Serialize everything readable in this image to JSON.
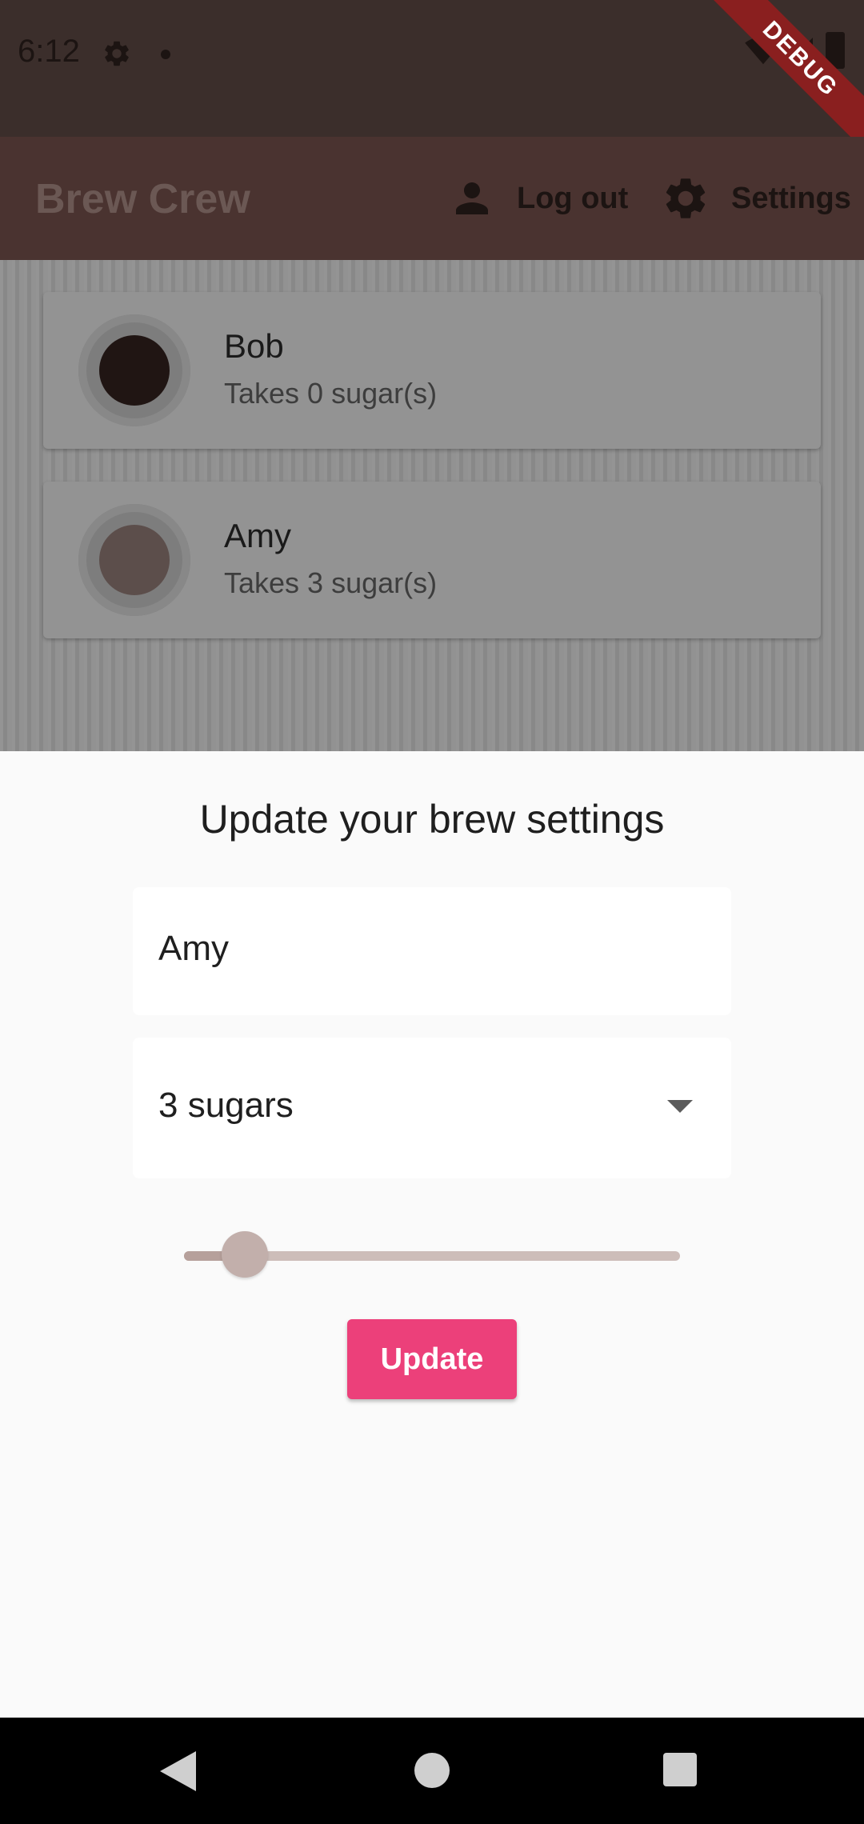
{
  "status_bar": {
    "time": "6:12",
    "debug_label": "DEBUG"
  },
  "app_bar": {
    "title": "Brew Crew",
    "logout_label": "Log out",
    "settings_label": "Settings"
  },
  "brews": [
    {
      "name": "Bob",
      "sugars_text": "Takes 0 sugar(s)",
      "strength_color": "#201513"
    },
    {
      "name": "Amy",
      "sugars_text": "Takes 3 sugar(s)",
      "strength_color": "#5c4e4b"
    }
  ],
  "settings_sheet": {
    "title": "Update your brew settings",
    "name_value": "Amy",
    "sugars_selected": "3 sugars",
    "strength_slider": {
      "value": 100,
      "min": 100,
      "max": 900
    },
    "update_label": "Update"
  },
  "colors": {
    "accent": "#ec407a",
    "app_bar": "#4a3330",
    "status_bar": "#3b2e2b"
  },
  "nav_bar": {
    "icons": [
      "back-icon",
      "home-icon",
      "recents-icon"
    ]
  }
}
